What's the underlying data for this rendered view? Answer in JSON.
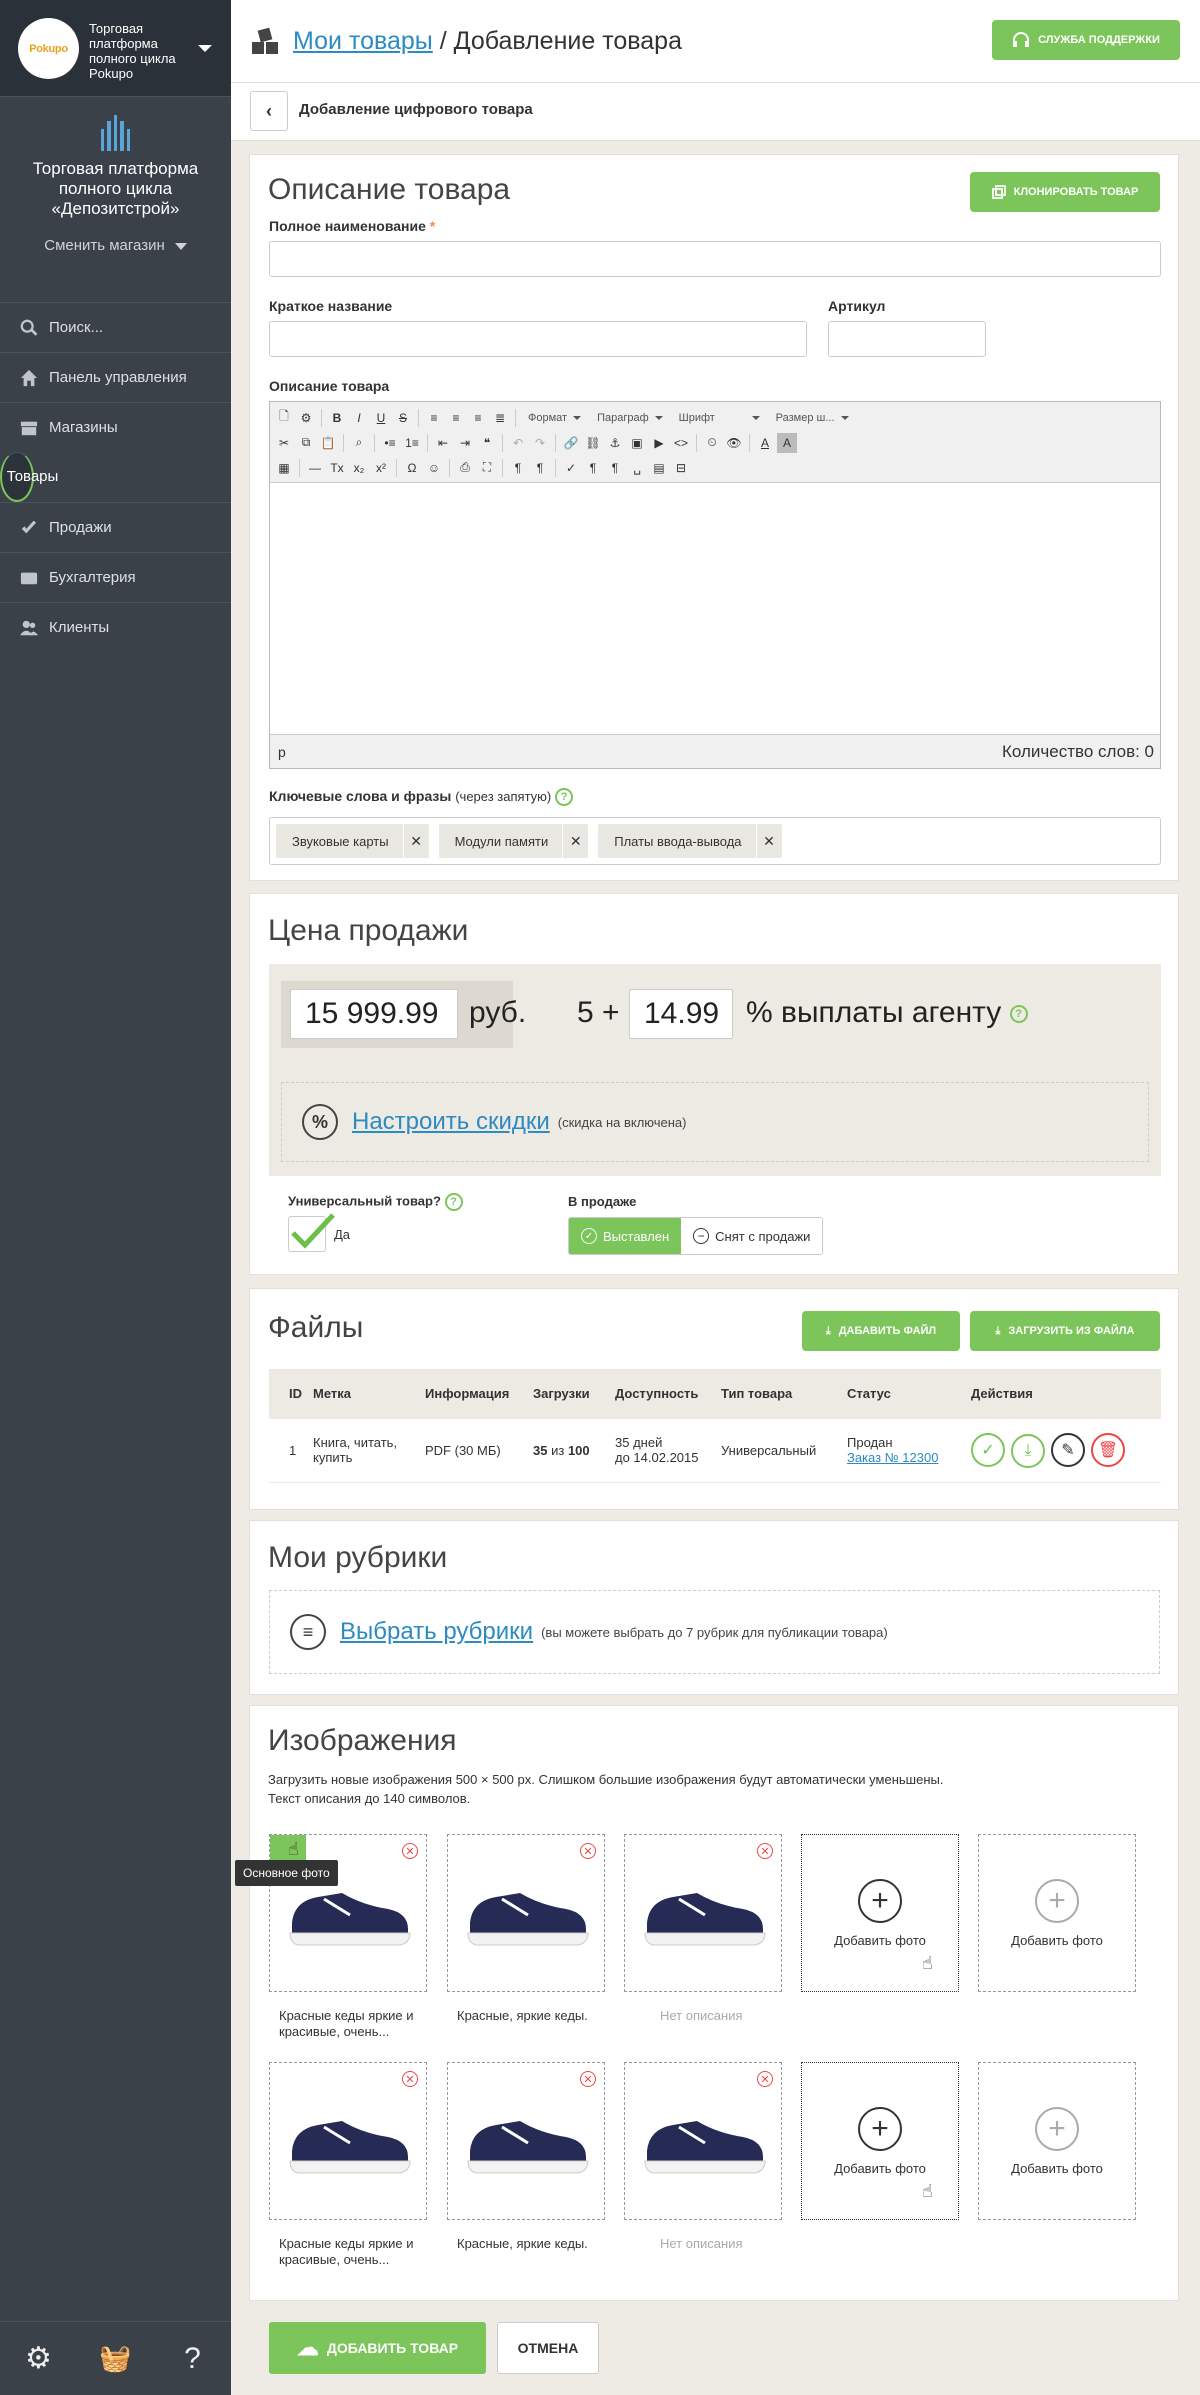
{
  "sidebar": {
    "logo_text": "Pokupo",
    "org": "Торговая платформа полного цикла Pokupo",
    "shop_name": "Торговая платформа полного цикла «Депозитстрой»",
    "switch_shop": "Сменить магазин",
    "items": [
      {
        "label": "Поиск...",
        "icon": "search-icon"
      },
      {
        "label": "Панель управления",
        "icon": "home-icon"
      },
      {
        "label": "Магазины",
        "icon": "store-icon"
      },
      {
        "label": "Товары",
        "icon": "boxes-icon"
      },
      {
        "label": "Продажи",
        "icon": "check-icon"
      },
      {
        "label": "Бухгалтерия",
        "icon": "wallet-icon"
      },
      {
        "label": "Клиенты",
        "icon": "users-icon"
      }
    ],
    "bottom": [
      "⚙",
      "🧺",
      "?"
    ]
  },
  "header": {
    "crumb_link": "Мои товары",
    "crumb_sep": " / ",
    "crumb_current": "Добавление товара",
    "support": "Служба поддержки",
    "sub_title": "Добавление цифрового товара"
  },
  "desc": {
    "title": "Описание товара",
    "clone": "Клонировать товар",
    "full_name": "Полное наименование",
    "req": "*",
    "short_name": "Краткое название",
    "sku": "Артикул",
    "desc_label": "Описание товара",
    "toolbar": {
      "format": "Формат",
      "paragraph": "Параграф",
      "font": "Шрифт",
      "size": "Размер ш..."
    },
    "path": "p",
    "words": "Количество слов: 0",
    "kw_label": "Ключевые слова и фразы",
    "kw_hint": "(через запятую)",
    "tags": [
      "Звуковые карты",
      "Модули памяти",
      "Платы ввода-вывода"
    ]
  },
  "price": {
    "title": "Цена продажи",
    "value": "15 999.99",
    "currency": "руб.",
    "five": "5 +",
    "percent": "14.99",
    "agent": "% выплаты агенту",
    "discount_link": "Настроить скидки",
    "discount_hint": "(скидка на включена)",
    "universal_label": "Универсальный товар?",
    "universal_value": "Да",
    "sale_label": "В продаже",
    "on": "Выставлен",
    "off": "Снят с продажи"
  },
  "files": {
    "title": "Файлы",
    "add": "Дабавить файл",
    "upload": "Загрузить из файла",
    "headers": [
      "ID",
      "Метка",
      "Информация",
      "Загрузки",
      "Доступность",
      "Тип товара",
      "Статус",
      "Действия"
    ],
    "row": {
      "id": "1",
      "label": "Книга, читать, купить",
      "info": "PDF (30 МБ)",
      "dl_a": "35",
      "dl_of": "из",
      "dl_b": "100",
      "avail1": "35 дней",
      "avail2": "до 14.02.2015",
      "type": "Универсальный",
      "status": "Продан",
      "order": "Заказ № 12300"
    }
  },
  "rubrics": {
    "title": "Мои рубрики",
    "link": "Выбрать рубрики",
    "hint": "(вы можете выбрать до 7 рубрик для публикации товара)"
  },
  "images": {
    "title": "Изображения",
    "hint1": "Загрузить новые изображения 500 × 500 px. Слишком большие изображения будут автоматически уменьшены.",
    "hint2": "Текст описания до 140 символов.",
    "tooltip": "Основное фото",
    "add": "Добавить фото",
    "captions": [
      "Красные кеды яркие и красивые, очень...",
      "Красные, яркие кеды.",
      "Нет описания"
    ]
  },
  "footer": {
    "add": "Добавить товар",
    "cancel": "Отмена"
  }
}
